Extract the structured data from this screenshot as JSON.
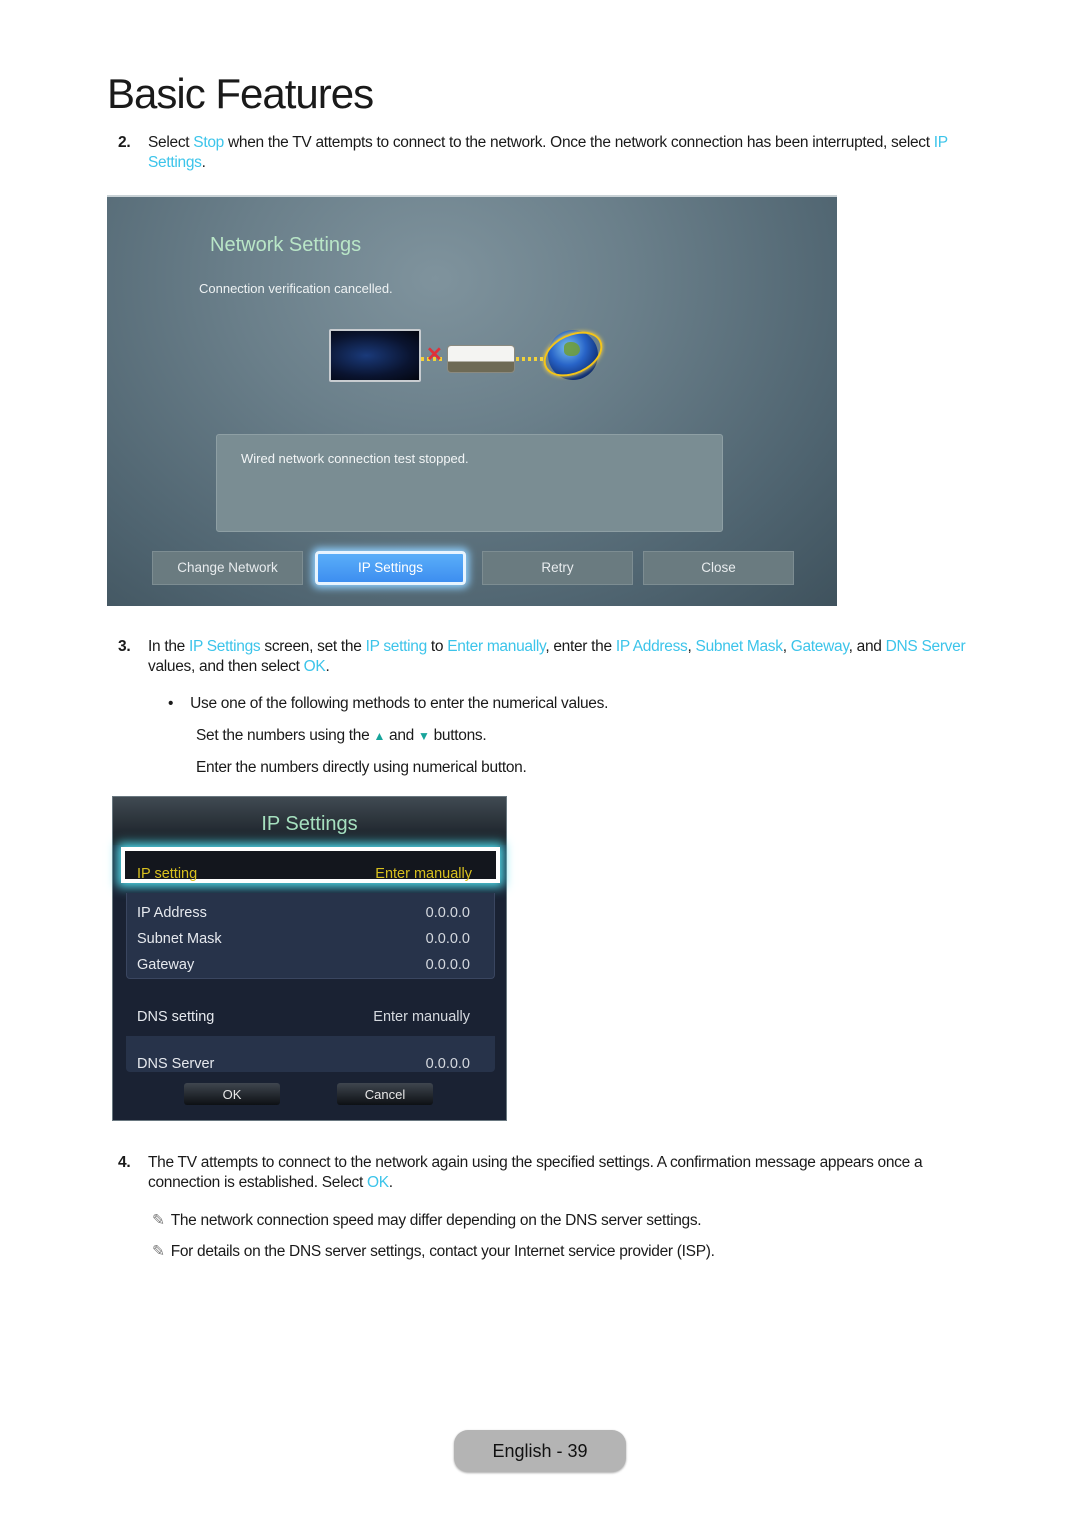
{
  "page": {
    "title": "Basic Features",
    "footer_label": "English - 39"
  },
  "colors": {
    "highlight": "#3cc4ea",
    "focus_yellow": "#d8c01e",
    "title_green": "#a6e0bf",
    "focus_blue": "#4a9ef5"
  },
  "step2": {
    "num": "2.",
    "t1": "Select ",
    "h1": "Stop",
    "t2": " when the TV attempts to connect to the network. Once the network connection has been interrupted, select ",
    "h2": "IP Settings",
    "t3": "."
  },
  "network_screen": {
    "title": "Network Settings",
    "status": "Connection verification cancelled.",
    "diagram": {
      "tv_icon": "tv-icon",
      "error_icon": "x-mark-icon",
      "router_icon": "router-icon",
      "internet_icon": "globe-icon"
    },
    "message": "Wired network connection test stopped.",
    "buttons": [
      {
        "label": "Change Network",
        "focused": false
      },
      {
        "label": "IP Settings",
        "focused": true
      },
      {
        "label": "Retry",
        "focused": false
      },
      {
        "label": "Close",
        "focused": false
      }
    ]
  },
  "step3": {
    "num": "3.",
    "t1": "In the ",
    "h1": "IP Settings",
    "t2": " screen, set the ",
    "h2": "IP setting",
    "t3": " to ",
    "h3": "Enter manually",
    "t4": ", enter the ",
    "h4": "IP Address",
    "t5": ", ",
    "h5": "Subnet Mask",
    "t6": ", ",
    "h6": "Gateway",
    "t7": ", and ",
    "h7": "DNS Server",
    "t8": " values, and then select ",
    "h8": "OK",
    "t9": "."
  },
  "bullet": {
    "text": "Use one of the following methods to enter the numerical values.",
    "line1_a": "Set the numbers using the ",
    "up_icon": "▲",
    "line1_b": " and ",
    "down_icon": "▼",
    "line1_c": " buttons.",
    "line2": "Enter the numbers directly using numerical button."
  },
  "ip_screen": {
    "title": "IP Settings",
    "ip_setting": {
      "label": "IP setting",
      "value": "Enter manually"
    },
    "fields": [
      {
        "label": "IP Address",
        "value": "0.0.0.0"
      },
      {
        "label": "Subnet Mask",
        "value": "0.0.0.0"
      },
      {
        "label": "Gateway",
        "value": "0.0.0.0"
      }
    ],
    "dns_setting": {
      "label": "DNS setting",
      "value": "Enter manually"
    },
    "dns_server": {
      "label": "DNS Server",
      "value": "0.0.0.0"
    },
    "ok_label": "OK",
    "cancel_label": "Cancel"
  },
  "step4": {
    "num": "4.",
    "t1": "The TV attempts to connect to the network again using the specified settings. A confirmation message appears once a connection is established. Select ",
    "h1": "OK",
    "t2": "."
  },
  "notes": [
    {
      "icon": "✎",
      "text": "The network connection speed may differ depending on the DNS server settings."
    },
    {
      "icon": "✎",
      "text": "For details on the DNS server settings, contact your Internet service provider (ISP)."
    }
  ]
}
